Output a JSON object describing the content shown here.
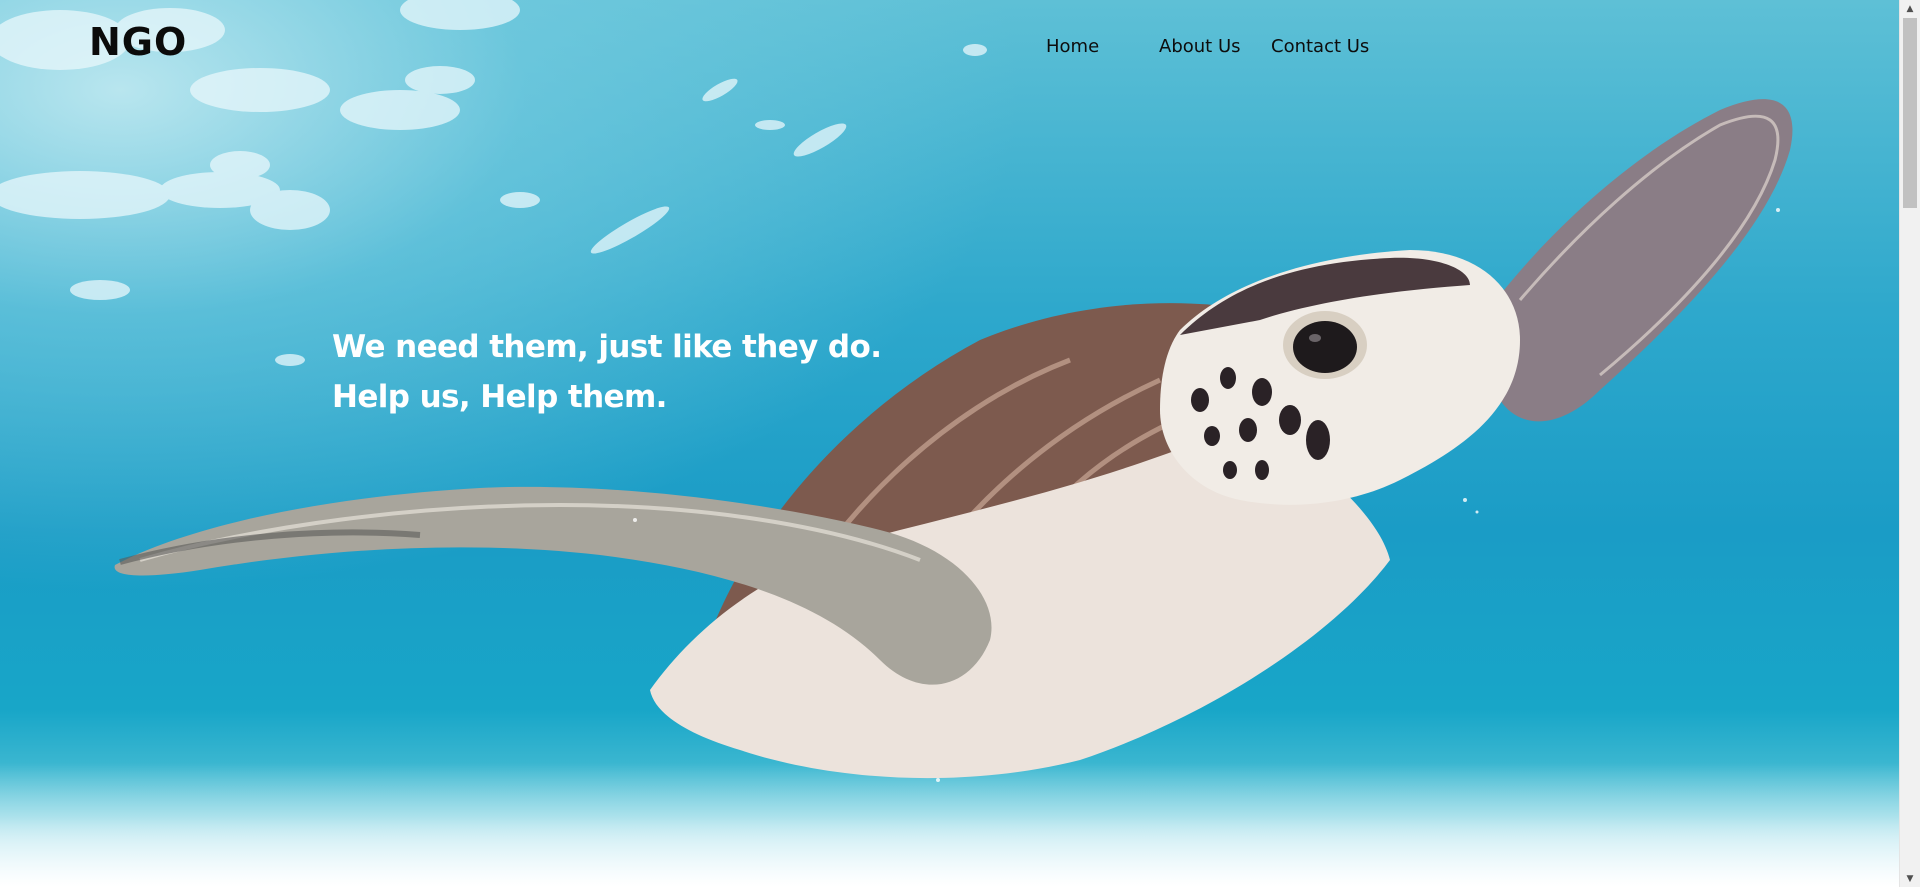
{
  "brand": {
    "logo": "NGO"
  },
  "nav": {
    "items": [
      {
        "label": "Home"
      },
      {
        "label": "About Us"
      },
      {
        "label": "Contact Us"
      }
    ]
  },
  "hero": {
    "tagline_line1": "We need them, just like they do.",
    "tagline_line2": "Help us, Help them.",
    "image_subject": "sea-turtle-underwater"
  },
  "colors": {
    "water_light": "#5ec0d6",
    "water_deep": "#1a9cc6",
    "text_dark": "#0b0b0b",
    "text_light": "#ffffff"
  }
}
